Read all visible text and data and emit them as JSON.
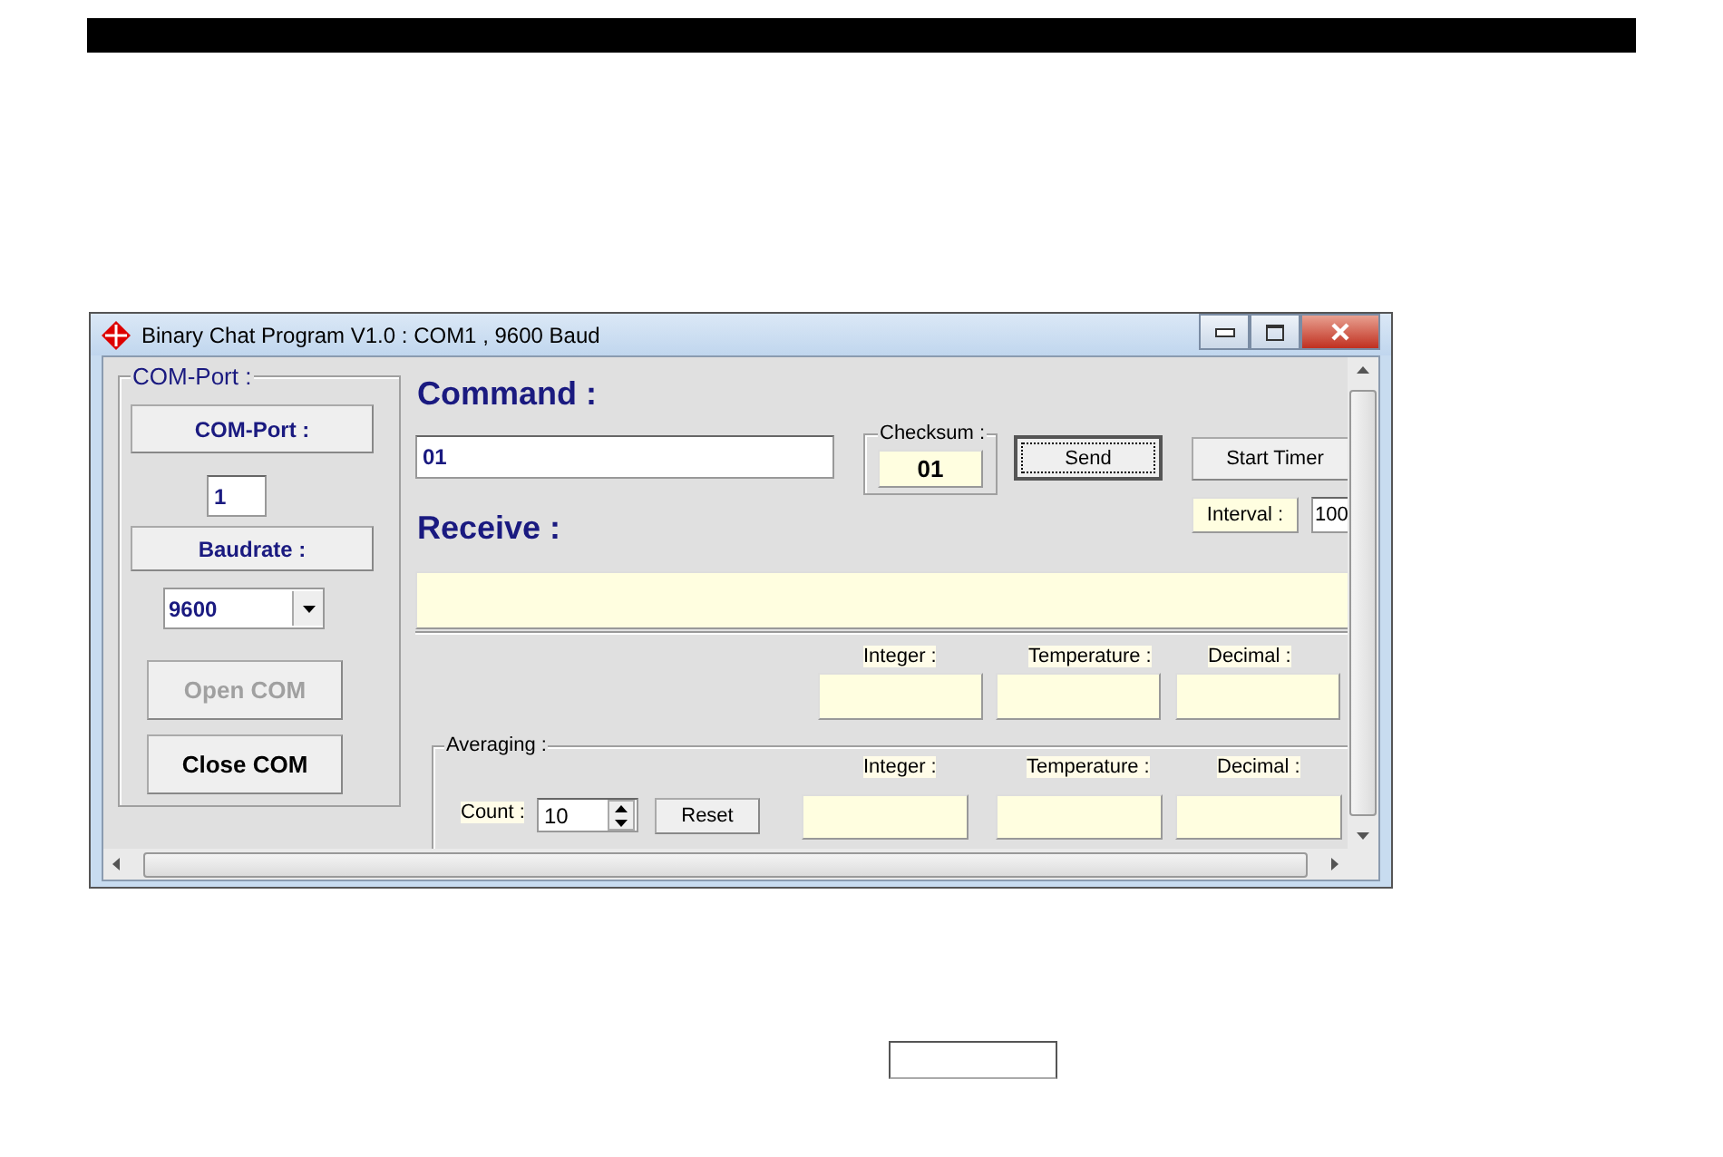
{
  "window": {
    "title": "Binary Chat Program V1.0 : COM1 , 9600 Baud"
  },
  "com_group": {
    "title": "COM-Port :",
    "port_button": "COM-Port :",
    "port_value": "1",
    "baud_button": "Baudrate :",
    "baud_value": "9600",
    "open_button": {
      "label": "Open COM",
      "disabled": true
    },
    "close_button": {
      "label": "Close COM",
      "disabled": false
    }
  },
  "command": {
    "heading": "Command :",
    "value": "01",
    "checksum_label": "Checksum :",
    "checksum": "01",
    "send": "Send",
    "start_timer": "Start Timer",
    "interval_label": "Interval :",
    "interval": "100"
  },
  "receive": {
    "heading": "Receive :",
    "outputs": [
      {
        "label": "Integer :"
      },
      {
        "label": "Temperature :"
      },
      {
        "label": "Decimal :"
      }
    ]
  },
  "averaging": {
    "title": "Averaging :",
    "count_label": "Count :",
    "count": "10",
    "reset": "Reset",
    "outputs": [
      {
        "label": "Integer :"
      },
      {
        "label": "Temperature :"
      },
      {
        "label": "Decimal :"
      }
    ]
  }
}
